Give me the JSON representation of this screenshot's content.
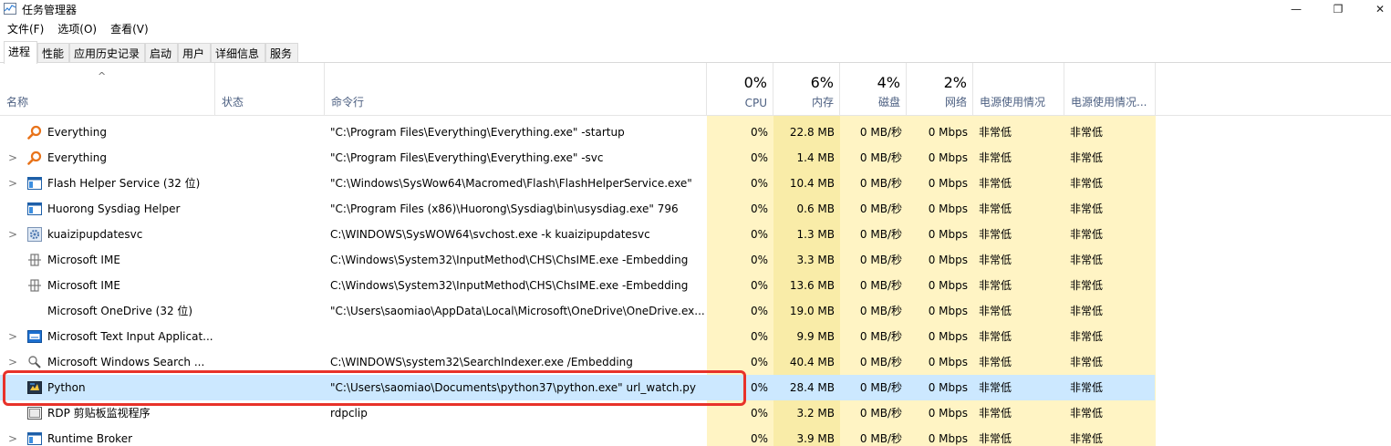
{
  "window": {
    "title": "任务管理器",
    "min_glyph": "—",
    "max_glyph": "❐",
    "close_glyph": "✕",
    "icon": "task-manager-icon"
  },
  "menu": [
    "文件(F)",
    "选项(O)",
    "查看(V)"
  ],
  "tabs": [
    {
      "label": "进程",
      "active": true
    },
    {
      "label": "性能"
    },
    {
      "label": "应用历史记录"
    },
    {
      "label": "启动"
    },
    {
      "label": "用户"
    },
    {
      "label": "详细信息"
    },
    {
      "label": "服务"
    }
  ],
  "header": {
    "sort_arrow": "^",
    "name": "名称",
    "status": "状态",
    "command": "命令行",
    "cpu": {
      "pct": "0%",
      "label": "CPU"
    },
    "memory": {
      "pct": "6%",
      "label": "内存"
    },
    "disk": {
      "pct": "4%",
      "label": "磁盘"
    },
    "network": {
      "pct": "2%",
      "label": "网络"
    },
    "power": "电源使用情况",
    "power_trend": "电源使用情况..."
  },
  "rows": [
    {
      "expand": "",
      "icon": "magnifier-icon",
      "name": "Everything",
      "cmd": "\"C:\\Program Files\\Everything\\Everything.exe\" -startup",
      "cpu": "0%",
      "mem": "22.8 MB",
      "disk": "0 MB/秒",
      "net": "0 Mbps",
      "pw": "非常低",
      "pwt": "非常低"
    },
    {
      "expand": ">",
      "icon": "magnifier-icon",
      "name": "Everything",
      "cmd": "\"C:\\Program Files\\Everything\\Everything.exe\" -svc",
      "cpu": "0%",
      "mem": "1.4 MB",
      "disk": "0 MB/秒",
      "net": "0 Mbps",
      "pw": "非常低",
      "pwt": "非常低"
    },
    {
      "expand": ">",
      "icon": "window-icon",
      "name": "Flash Helper Service (32 位)",
      "cmd": "\"C:\\Windows\\SysWow64\\Macromed\\Flash\\FlashHelperService.exe\"",
      "cpu": "0%",
      "mem": "10.4 MB",
      "disk": "0 MB/秒",
      "net": "0 Mbps",
      "pw": "非常低",
      "pwt": "非常低"
    },
    {
      "expand": "",
      "icon": "window-icon",
      "name": "Huorong Sysdiag Helper",
      "cmd": "\"C:\\Program Files (x86)\\Huorong\\Sysdiag\\bin\\usysdiag.exe\" 796",
      "cpu": "0%",
      "mem": "0.6 MB",
      "disk": "0 MB/秒",
      "net": "0 Mbps",
      "pw": "非常低",
      "pwt": "非常低"
    },
    {
      "expand": ">",
      "icon": "gear-icon",
      "name": "kuaizipupdatesvc",
      "cmd": "C:\\WINDOWS\\SysWOW64\\svchost.exe -k kuaizipupdatesvc",
      "cpu": "0%",
      "mem": "1.3 MB",
      "disk": "0 MB/秒",
      "net": "0 Mbps",
      "pw": "非常低",
      "pwt": "非常低"
    },
    {
      "expand": "",
      "icon": "ime-icon",
      "name": "Microsoft IME",
      "cmd": "C:\\Windows\\System32\\InputMethod\\CHS\\ChsIME.exe -Embedding",
      "cpu": "0%",
      "mem": "3.3 MB",
      "disk": "0 MB/秒",
      "net": "0 Mbps",
      "pw": "非常低",
      "pwt": "非常低"
    },
    {
      "expand": "",
      "icon": "ime-icon",
      "name": "Microsoft IME",
      "cmd": "C:\\Windows\\System32\\InputMethod\\CHS\\ChsIME.exe -Embedding",
      "cpu": "0%",
      "mem": "13.6 MB",
      "disk": "0 MB/秒",
      "net": "0 Mbps",
      "pw": "非常低",
      "pwt": "非常低"
    },
    {
      "expand": "",
      "icon": "",
      "name": "Microsoft OneDrive (32 位)",
      "cmd": "\"C:\\Users\\saomiao\\AppData\\Local\\Microsoft\\OneDrive\\OneDrive.ex...",
      "cpu": "0%",
      "mem": "19.0 MB",
      "disk": "0 MB/秒",
      "net": "0 Mbps",
      "pw": "非常低",
      "pwt": "非常低"
    },
    {
      "expand": ">",
      "icon": "keyboard-icon",
      "name": "Microsoft Text Input Applicat...",
      "cmd": "",
      "cpu": "0%",
      "mem": "9.9 MB",
      "disk": "0 MB/秒",
      "net": "0 Mbps",
      "pw": "非常低",
      "pwt": "非常低"
    },
    {
      "expand": ">",
      "icon": "search-person-icon",
      "name": "Microsoft Windows Search ...",
      "cmd": "C:\\WINDOWS\\system32\\SearchIndexer.exe /Embedding",
      "cpu": "0%",
      "mem": "40.4 MB",
      "disk": "0 MB/秒",
      "net": "0 Mbps",
      "pw": "非常低",
      "pwt": "非常低"
    },
    {
      "expand": "",
      "icon": "python-icon",
      "name": "Python",
      "cmd": "\"C:\\Users\\saomiao\\Documents\\python37\\python.exe\" url_watch.py",
      "cpu": "0%",
      "mem": "28.4 MB",
      "disk": "0 MB/秒",
      "net": "0 Mbps",
      "pw": "非常低",
      "pwt": "非常低",
      "selected": true
    },
    {
      "expand": "",
      "icon": "clipboard-icon",
      "name": "RDP 剪贴板监视程序",
      "cmd": "rdpclip",
      "cpu": "0%",
      "mem": "3.2 MB",
      "disk": "0 MB/秒",
      "net": "0 Mbps",
      "pw": "非常低",
      "pwt": "非常低"
    },
    {
      "expand": ">",
      "icon": "window-icon",
      "name": "Runtime Broker",
      "cmd": "",
      "cpu": "0%",
      "mem": "3.9 MB",
      "disk": "0 MB/秒",
      "net": "0 Mbps",
      "pw": "非常低",
      "pwt": "非常低"
    }
  ],
  "colors": {
    "highlight_border": "#e8322a",
    "selected_row": "#cce8ff",
    "column_yellow": "#fff4c4",
    "header_label": "#4d6082"
  }
}
